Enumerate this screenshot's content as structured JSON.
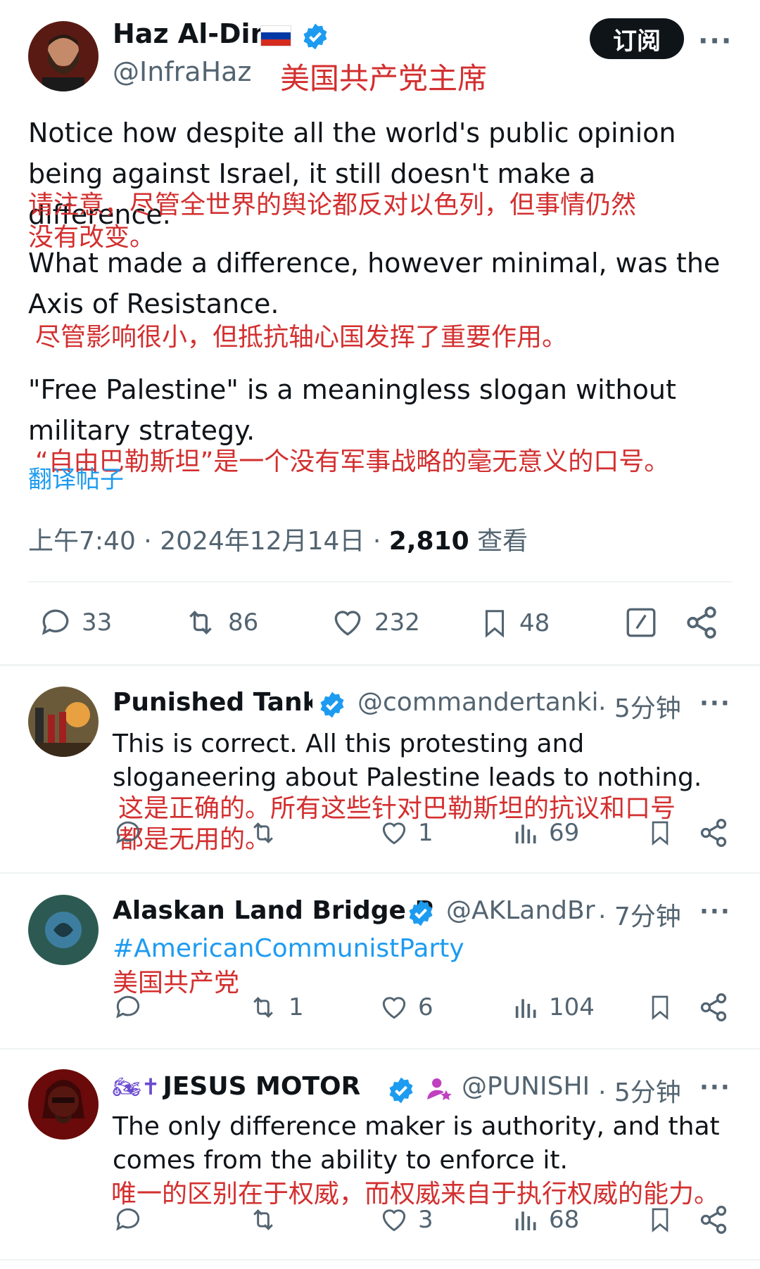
{
  "main": {
    "author_name": "Haz Al-Din",
    "author_handle": "@InfraHaz",
    "author_note": "美国共产党主席",
    "subscribe_label": "订阅",
    "more_label": "···",
    "text_p1": "Notice how despite all the world's public opinion being against Israel, it still doesn't make a difference.",
    "text_p1_cn_line1": "请注意，尽管全世界的舆论都反对以色列，但事情仍然",
    "text_p1_cn_line2": "没有改变。",
    "text_p2": "What made a difference, however minimal, was the Axis of Resistance.",
    "text_p2_cn": "尽管影响很小，但抵抗轴心国发挥了重要作用。",
    "text_p3": "\"Free Palestine\" is a meaningless slogan without military strategy.",
    "text_p3_cn": "“自由巴勒斯坦”是一个没有军事战略的毫无意义的口号。",
    "translate_label": "翻译帖子",
    "time": "上午7:40",
    "date": "2024年12月14日",
    "views_count": "2,810",
    "views_label": "查看",
    "replies": "33",
    "retweets": "86",
    "likes": "232",
    "bookmarks": "48"
  },
  "replies": [
    {
      "name": "Punished Tanki",
      "handle": "@commandertanki",
      "time": "· 5分钟",
      "text": "This is correct. All this protesting and sloganeering about Palestine leads to nothing.",
      "cn_line1": "这是正确的。所有这些针对巴勒斯坦的抗议和口号",
      "cn_line2": "都是无用的。",
      "replies": "",
      "retweets": "",
      "likes": "1",
      "views": "69"
    },
    {
      "name": "Alaskan Land Bridge P",
      "handle": "@AKLandBr",
      "time": "· 7分钟",
      "hashtag": "#AmericanCommunistParty",
      "cn_line1": "美国共产党",
      "replies": "",
      "retweets": "1",
      "likes": "6",
      "views": "104"
    },
    {
      "name": "JESUS MOTOR",
      "name_prefix": "🏍✝",
      "handle": "@PUNISHI",
      "time": "· 5分钟",
      "text": "The only difference maker is authority, and that comes from the ability to enforce it.",
      "cn_line1": "唯一的区别在于权威，而权威来自于执行权威的能力。",
      "replies": "",
      "retweets": "",
      "likes": "3",
      "views": "68"
    }
  ],
  "colors": {
    "accent": "#1d9bf0",
    "annotation_red": "#d32f2f",
    "muted": "#536471",
    "russia_white": "#ffffff",
    "russia_blue": "#0039a6",
    "russia_red": "#d52b1e"
  }
}
